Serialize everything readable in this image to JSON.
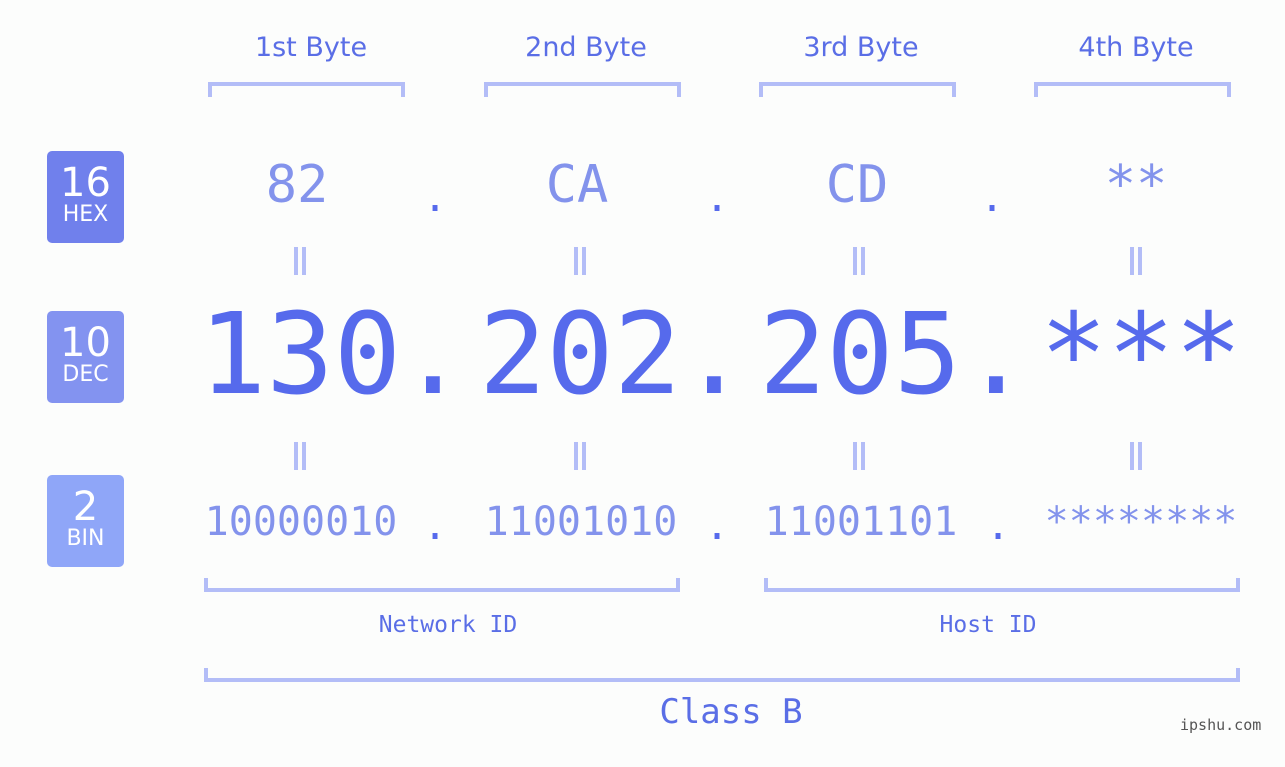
{
  "byte_headers": [
    "1st Byte",
    "2nd Byte",
    "3rd Byte",
    "4th Byte"
  ],
  "badges": [
    {
      "number": "16",
      "label": "HEX",
      "color": "#7080ec"
    },
    {
      "number": "10",
      "label": "DEC",
      "color": "#8393f0"
    },
    {
      "number": "2",
      "label": "BIN",
      "color": "#8fa6f8"
    }
  ],
  "hex": [
    "82",
    "CA",
    "CD",
    "**"
  ],
  "dec": [
    "130",
    "202",
    "205",
    "***"
  ],
  "bin": [
    "10000010",
    "11001010",
    "11001101",
    "********"
  ],
  "separator": ".",
  "network_id_label": "Network ID",
  "host_id_label": "Host ID",
  "class_label": "Class B",
  "watermark": "ipshu.com",
  "colors": {
    "primary": "#566aec",
    "light": "#8393ec",
    "bracket": "#b3bdf7"
  }
}
